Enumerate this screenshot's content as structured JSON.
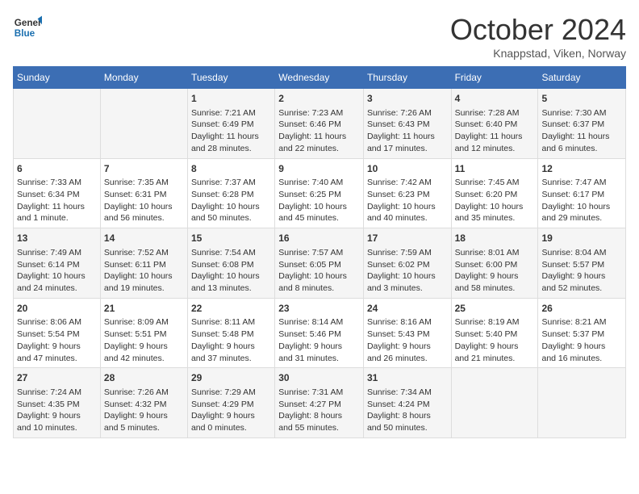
{
  "header": {
    "logo": {
      "line1": "General",
      "line2": "Blue"
    },
    "title": "October 2024",
    "location": "Knappstad, Viken, Norway"
  },
  "weekdays": [
    "Sunday",
    "Monday",
    "Tuesday",
    "Wednesday",
    "Thursday",
    "Friday",
    "Saturday"
  ],
  "weeks": [
    [
      {
        "day": "",
        "info": ""
      },
      {
        "day": "",
        "info": ""
      },
      {
        "day": "1",
        "info": "Sunrise: 7:21 AM\nSunset: 6:49 PM\nDaylight: 11 hours\nand 28 minutes."
      },
      {
        "day": "2",
        "info": "Sunrise: 7:23 AM\nSunset: 6:46 PM\nDaylight: 11 hours\nand 22 minutes."
      },
      {
        "day": "3",
        "info": "Sunrise: 7:26 AM\nSunset: 6:43 PM\nDaylight: 11 hours\nand 17 minutes."
      },
      {
        "day": "4",
        "info": "Sunrise: 7:28 AM\nSunset: 6:40 PM\nDaylight: 11 hours\nand 12 minutes."
      },
      {
        "day": "5",
        "info": "Sunrise: 7:30 AM\nSunset: 6:37 PM\nDaylight: 11 hours\nand 6 minutes."
      }
    ],
    [
      {
        "day": "6",
        "info": "Sunrise: 7:33 AM\nSunset: 6:34 PM\nDaylight: 11 hours\nand 1 minute."
      },
      {
        "day": "7",
        "info": "Sunrise: 7:35 AM\nSunset: 6:31 PM\nDaylight: 10 hours\nand 56 minutes."
      },
      {
        "day": "8",
        "info": "Sunrise: 7:37 AM\nSunset: 6:28 PM\nDaylight: 10 hours\nand 50 minutes."
      },
      {
        "day": "9",
        "info": "Sunrise: 7:40 AM\nSunset: 6:25 PM\nDaylight: 10 hours\nand 45 minutes."
      },
      {
        "day": "10",
        "info": "Sunrise: 7:42 AM\nSunset: 6:23 PM\nDaylight: 10 hours\nand 40 minutes."
      },
      {
        "day": "11",
        "info": "Sunrise: 7:45 AM\nSunset: 6:20 PM\nDaylight: 10 hours\nand 35 minutes."
      },
      {
        "day": "12",
        "info": "Sunrise: 7:47 AM\nSunset: 6:17 PM\nDaylight: 10 hours\nand 29 minutes."
      }
    ],
    [
      {
        "day": "13",
        "info": "Sunrise: 7:49 AM\nSunset: 6:14 PM\nDaylight: 10 hours\nand 24 minutes."
      },
      {
        "day": "14",
        "info": "Sunrise: 7:52 AM\nSunset: 6:11 PM\nDaylight: 10 hours\nand 19 minutes."
      },
      {
        "day": "15",
        "info": "Sunrise: 7:54 AM\nSunset: 6:08 PM\nDaylight: 10 hours\nand 13 minutes."
      },
      {
        "day": "16",
        "info": "Sunrise: 7:57 AM\nSunset: 6:05 PM\nDaylight: 10 hours\nand 8 minutes."
      },
      {
        "day": "17",
        "info": "Sunrise: 7:59 AM\nSunset: 6:02 PM\nDaylight: 10 hours\nand 3 minutes."
      },
      {
        "day": "18",
        "info": "Sunrise: 8:01 AM\nSunset: 6:00 PM\nDaylight: 9 hours\nand 58 minutes."
      },
      {
        "day": "19",
        "info": "Sunrise: 8:04 AM\nSunset: 5:57 PM\nDaylight: 9 hours\nand 52 minutes."
      }
    ],
    [
      {
        "day": "20",
        "info": "Sunrise: 8:06 AM\nSunset: 5:54 PM\nDaylight: 9 hours\nand 47 minutes."
      },
      {
        "day": "21",
        "info": "Sunrise: 8:09 AM\nSunset: 5:51 PM\nDaylight: 9 hours\nand 42 minutes."
      },
      {
        "day": "22",
        "info": "Sunrise: 8:11 AM\nSunset: 5:48 PM\nDaylight: 9 hours\nand 37 minutes."
      },
      {
        "day": "23",
        "info": "Sunrise: 8:14 AM\nSunset: 5:46 PM\nDaylight: 9 hours\nand 31 minutes."
      },
      {
        "day": "24",
        "info": "Sunrise: 8:16 AM\nSunset: 5:43 PM\nDaylight: 9 hours\nand 26 minutes."
      },
      {
        "day": "25",
        "info": "Sunrise: 8:19 AM\nSunset: 5:40 PM\nDaylight: 9 hours\nand 21 minutes."
      },
      {
        "day": "26",
        "info": "Sunrise: 8:21 AM\nSunset: 5:37 PM\nDaylight: 9 hours\nand 16 minutes."
      }
    ],
    [
      {
        "day": "27",
        "info": "Sunrise: 7:24 AM\nSunset: 4:35 PM\nDaylight: 9 hours\nand 10 minutes."
      },
      {
        "day": "28",
        "info": "Sunrise: 7:26 AM\nSunset: 4:32 PM\nDaylight: 9 hours\nand 5 minutes."
      },
      {
        "day": "29",
        "info": "Sunrise: 7:29 AM\nSunset: 4:29 PM\nDaylight: 9 hours\nand 0 minutes."
      },
      {
        "day": "30",
        "info": "Sunrise: 7:31 AM\nSunset: 4:27 PM\nDaylight: 8 hours\nand 55 minutes."
      },
      {
        "day": "31",
        "info": "Sunrise: 7:34 AM\nSunset: 4:24 PM\nDaylight: 8 hours\nand 50 minutes."
      },
      {
        "day": "",
        "info": ""
      },
      {
        "day": "",
        "info": ""
      }
    ]
  ]
}
